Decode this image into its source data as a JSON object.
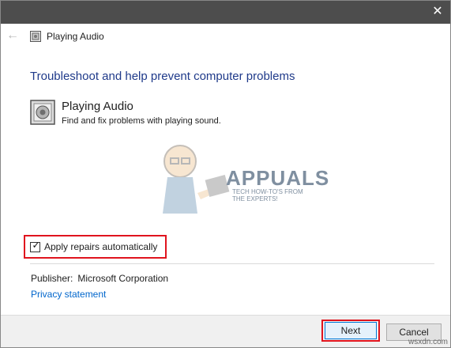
{
  "window": {
    "close_glyph": "✕"
  },
  "nav": {
    "back_glyph": "←",
    "title": "Playing Audio",
    "icon": "audio-icon"
  },
  "main": {
    "headline": "Troubleshoot and help prevent computer problems",
    "item": {
      "title": "Playing Audio",
      "description": "Find and fix problems with playing sound.",
      "icon": "audio-troubleshooter-icon"
    },
    "checkbox": {
      "label": "Apply repairs automatically",
      "checked": true,
      "check_glyph": "✓"
    },
    "publisher": {
      "label": "Publisher:",
      "value": "Microsoft Corporation"
    },
    "privacy_link": "Privacy statement"
  },
  "watermark": {
    "text": "APPUALS",
    "sub": "TECH HOW-TO'S FROM THE EXPERTS!"
  },
  "footer": {
    "next_label": "Next",
    "cancel_label": "Cancel"
  },
  "source_mark": "wsxdn.com",
  "colors": {
    "titlebar": "#4d4d4d",
    "headline": "#1f3a8a",
    "link": "#0066cc",
    "highlight": "#e0141e"
  }
}
